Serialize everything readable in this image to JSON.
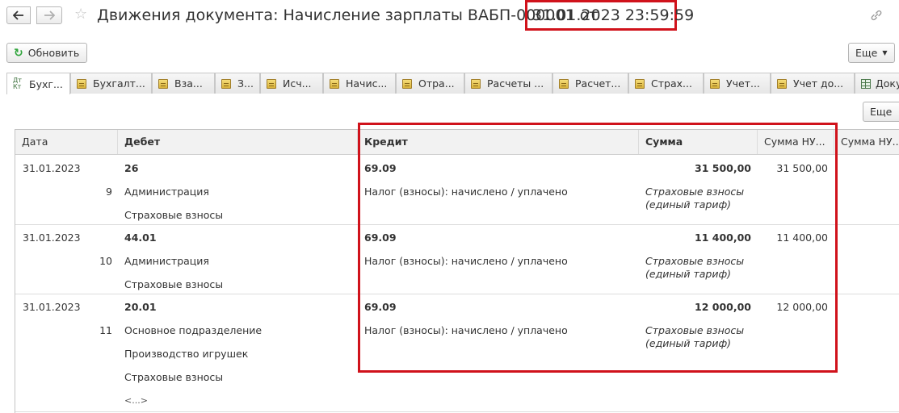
{
  "header": {
    "title": "Движения документа: Начисление зарплаты ВАБП-000001 от",
    "date": "31.01.2023 23:59:59",
    "back_icon": "arrow-left-icon",
    "forward_icon": "arrow-right-icon",
    "favorite_icon": "star-icon",
    "link_icon": "link-icon"
  },
  "toolbar": {
    "refresh_label": "Обновить",
    "more_label": "Еще"
  },
  "tabs": [
    {
      "label": "Бухг...",
      "icon": "dt-kt-icon",
      "active": true
    },
    {
      "label": "Бухгалт...",
      "icon": "register-icon"
    },
    {
      "label": "Вза...",
      "icon": "register-icon"
    },
    {
      "label": "З...",
      "icon": "register-icon"
    },
    {
      "label": "Исч...",
      "icon": "register-icon"
    },
    {
      "label": "Начис...",
      "icon": "register-icon"
    },
    {
      "label": "Отра...",
      "icon": "register-icon"
    },
    {
      "label": "Расчеты ...",
      "icon": "register-icon"
    },
    {
      "label": "Расчет...",
      "icon": "register-icon"
    },
    {
      "label": "Страх...",
      "icon": "register-icon"
    },
    {
      "label": "Учет...",
      "icon": "register-icon"
    },
    {
      "label": "Учет до...",
      "icon": "register-icon"
    },
    {
      "label": "Доку",
      "icon": "grid-icon"
    }
  ],
  "panel": {
    "more_label": "Еще"
  },
  "table": {
    "columns": [
      "Дата",
      "Дебет",
      "Кредит",
      "Сумма",
      "Сумма НУ...",
      "Сумма НУ..."
    ],
    "rows": [
      {
        "date": "31.01.2023",
        "num": "9",
        "debit": [
          "26",
          "Администрация",
          "Страховые взносы"
        ],
        "credit": [
          "69.09",
          "Налог (взносы): начислено / уплачено"
        ],
        "sum": "31 500,00",
        "sum_note": "Страховые взносы (единый тариф)",
        "sum_nu": "31 500,00"
      },
      {
        "date": "31.01.2023",
        "num": "10",
        "debit": [
          "44.01",
          "Администрация",
          "Страховые взносы"
        ],
        "credit": [
          "69.09",
          "Налог (взносы): начислено / уплачено"
        ],
        "sum": "11 400,00",
        "sum_note": "Страховые взносы (единый тариф)",
        "sum_nu": "11 400,00"
      },
      {
        "date": "31.01.2023",
        "num": "11",
        "debit": [
          "20.01",
          "Основное подразделение",
          "Производство игрушек",
          "Страховые взносы",
          "<...>"
        ],
        "credit": [
          "69.09",
          "Налог (взносы): начислено / уплачено"
        ],
        "sum": "12 000,00",
        "sum_note": "Страховые взносы (единый тариф)",
        "sum_nu": "12 000,00"
      }
    ]
  },
  "colors": {
    "highlight": "#d0121b",
    "refresh_icon": "#2ea43a"
  }
}
